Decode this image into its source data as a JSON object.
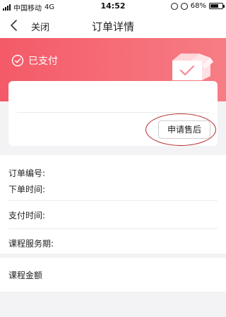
{
  "status_bar": {
    "carrier": "中国移动",
    "network": "4G",
    "time": "14:52",
    "battery_text": "68%",
    "battery_level": 0.68
  },
  "nav": {
    "close_label": "关闭",
    "title": "订单详情",
    "back_icon": "chevron-left-icon"
  },
  "header": {
    "status_text": "已支付",
    "status_icon": "check-circle-icon",
    "decoration_icon": "box-icon",
    "bg_color_start": "#f45a68",
    "bg_color_end": "#f77d85"
  },
  "card": {
    "after_sale_label": "申请售后"
  },
  "info": {
    "order_number_label": "订单编号:",
    "order_time_label": "下单时间:",
    "pay_time_label": "支付时间:",
    "service_period_label": "课程服务期:"
  },
  "price": {
    "amount_label": "课程金额"
  },
  "accent_color": "#f45a68"
}
